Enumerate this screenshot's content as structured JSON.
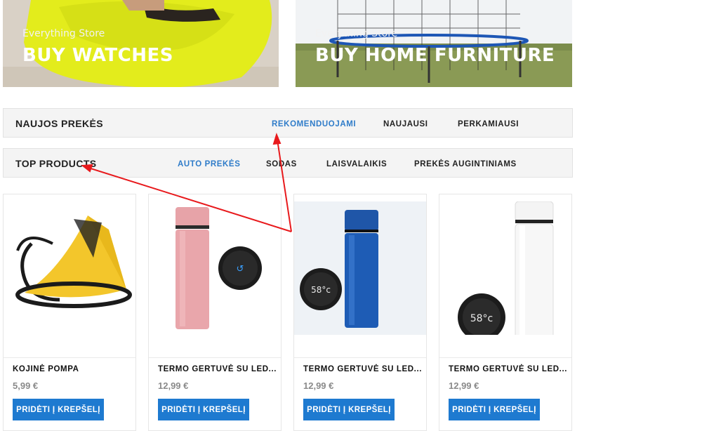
{
  "banners": [
    {
      "subtitle": "Everything Store",
      "title": "BUY WATCHES"
    },
    {
      "subtitle": "Everything Store",
      "title": "BUY HOME FURNITURE"
    }
  ],
  "new_products_bar": {
    "title": "NAUJOS PREKĖS",
    "tabs": [
      {
        "label": "REKOMENDUOJAMI",
        "active": true
      },
      {
        "label": "NAUJAUSI",
        "active": false
      },
      {
        "label": "PERKAMIAUSI",
        "active": false
      }
    ]
  },
  "top_products_bar": {
    "title": "TOP PRODUCTS",
    "tabs": [
      {
        "label": "AUTO PREKĖS",
        "active": true
      },
      {
        "label": "SODAS",
        "active": false
      },
      {
        "label": "LAISVALAIKIS",
        "active": false
      },
      {
        "label": "PREKĖS AUGINTINIAMS",
        "active": false
      }
    ]
  },
  "products": [
    {
      "name": "KOJINĖ POMPA",
      "price": "5,99 €",
      "button": "PRIDĖTI Į KREPŠELĮ"
    },
    {
      "name": "TERMO GERTUVĖ SU LED...",
      "price": "12,99 €",
      "button": "PRIDĖTI Į KREPŠELĮ"
    },
    {
      "name": "TERMO GERTUVĖ SU LED...",
      "price": "12,99 €",
      "button": "PRIDĖTI Į KREPŠELĮ"
    },
    {
      "name": "TERMO GERTUVĖ SU LED...",
      "price": "12,99 €",
      "button": "PRIDĖTI Į KREPŠELĮ"
    }
  ],
  "colors": {
    "accent": "#1e7ad0",
    "active_tab": "#2f7cc9",
    "annotation_arrow": "#e8191c"
  }
}
